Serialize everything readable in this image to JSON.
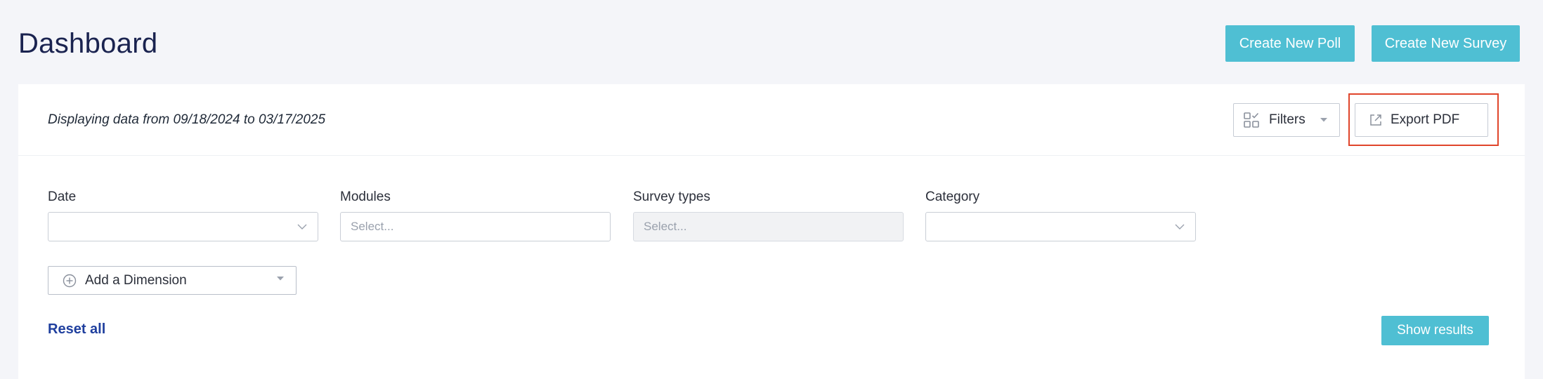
{
  "header": {
    "title": "Dashboard",
    "create_poll_label": "Create New Poll",
    "create_survey_label": "Create New Survey"
  },
  "toolbar": {
    "display_range": "Displaying data from 09/18/2024 to 03/17/2025",
    "filters_label": "Filters",
    "export_label": "Export PDF"
  },
  "filters": {
    "date": {
      "label": "Date",
      "value": ""
    },
    "modules": {
      "label": "Modules",
      "placeholder": "Select..."
    },
    "survey_types": {
      "label": "Survey types",
      "placeholder": "Select..."
    },
    "category": {
      "label": "Category",
      "value": ""
    },
    "add_dimension_label": "Add a Dimension",
    "reset_label": "Reset all",
    "show_results_label": "Show results"
  },
  "colors": {
    "accent": "#4fbfd3",
    "title": "#1a2350",
    "link": "#1f3f9e",
    "highlight": "#e0452b"
  },
  "icons": {
    "filters": "filter-grid-icon",
    "export": "export-arrow-icon",
    "add": "plus-circle-icon",
    "dropdown": "chevron-down-icon"
  }
}
